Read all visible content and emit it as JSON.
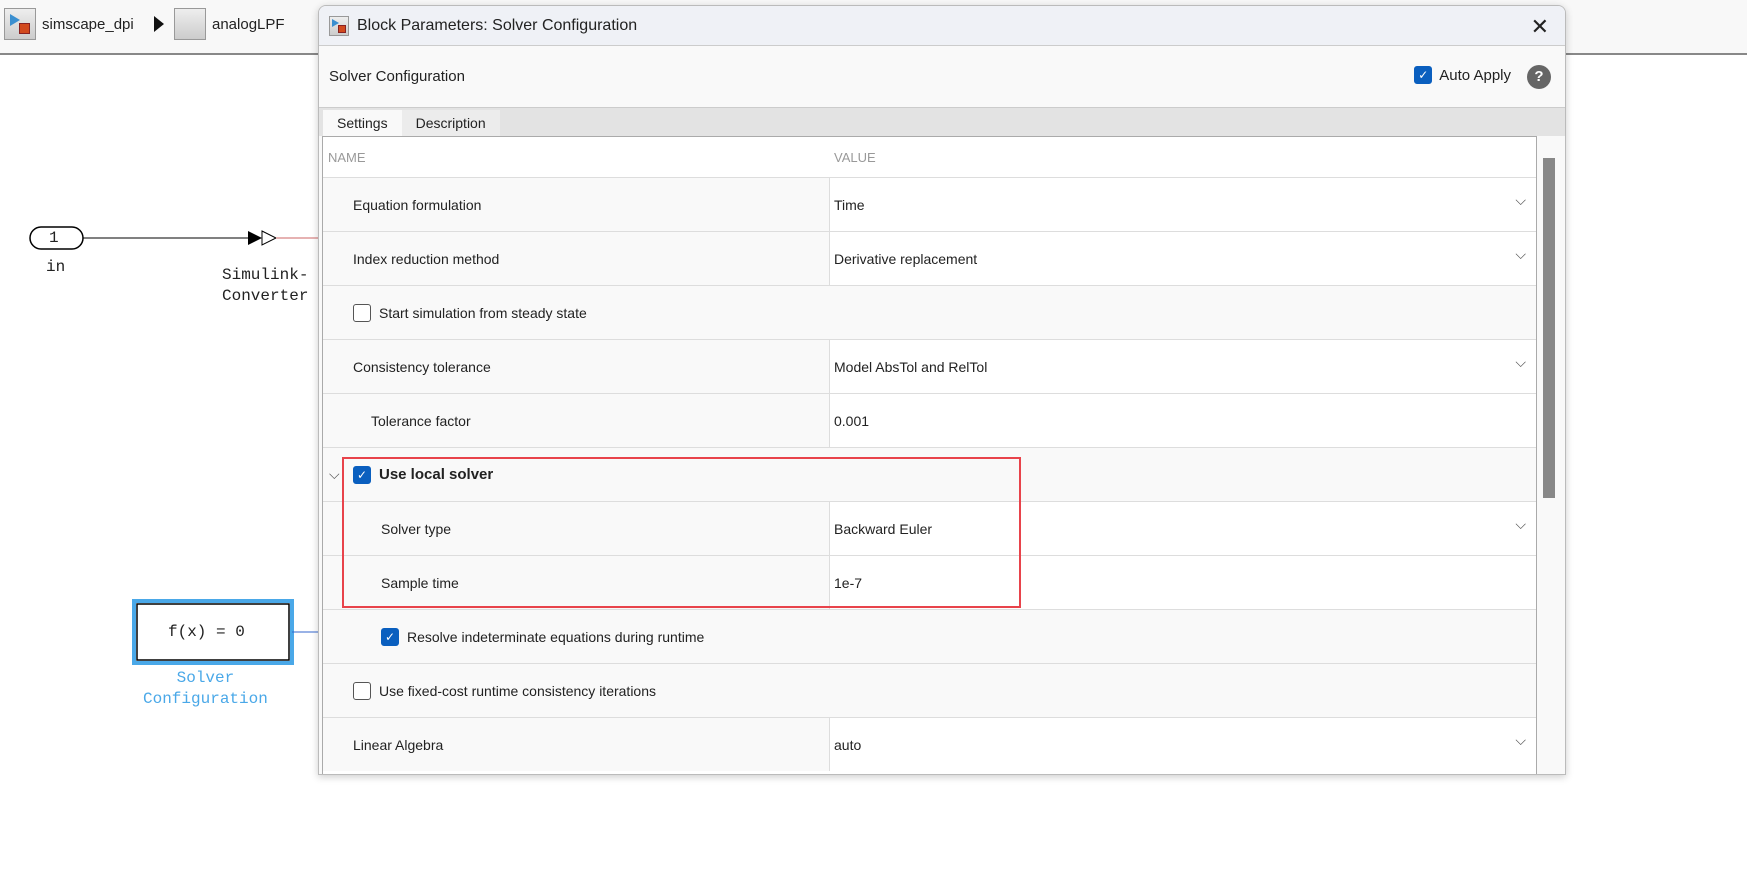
{
  "breadcrumb": {
    "model": "simscape_dpi",
    "subsystem": "analogLPF"
  },
  "canvas": {
    "inport_number": "1",
    "inport_label": "in",
    "converter_label": "Simulink-\nConverter",
    "solver_block_text": "f(x) = 0",
    "solver_block_label": "Solver\nConfiguration",
    "accent": "#4aa8e8"
  },
  "dialog": {
    "title": "Block Parameters: Solver Configuration",
    "header": "Solver Configuration",
    "auto_apply": "Auto Apply",
    "auto_apply_checked": true,
    "tabs": [
      "Settings",
      "Description"
    ],
    "columns": [
      "NAME",
      "VALUE"
    ],
    "rows": [
      {
        "name": "Equation formulation",
        "value": "Time",
        "type": "dropdown"
      },
      {
        "name": "Index reduction method",
        "value": "Derivative replacement",
        "type": "dropdown"
      },
      {
        "name": "Start simulation from steady state",
        "checked": false,
        "type": "checkbox"
      },
      {
        "name": "Consistency tolerance",
        "value": "Model AbsTol and RelTol",
        "type": "dropdown"
      },
      {
        "name": "Tolerance factor",
        "value": "0.001",
        "type": "text"
      },
      {
        "name": "Use local solver",
        "checked": true,
        "type": "group"
      },
      {
        "name": "Solver type",
        "value": "Backward Euler",
        "type": "dropdown"
      },
      {
        "name": "Sample time",
        "value": "1e-7",
        "type": "text"
      },
      {
        "name": "Resolve indeterminate equations during runtime",
        "checked": true,
        "type": "checkbox"
      },
      {
        "name": "Use fixed-cost runtime consistency iterations",
        "checked": false,
        "type": "checkbox"
      },
      {
        "name": "Linear Algebra",
        "value": "auto",
        "type": "dropdown"
      }
    ]
  },
  "highlight_color": "#e8434b"
}
